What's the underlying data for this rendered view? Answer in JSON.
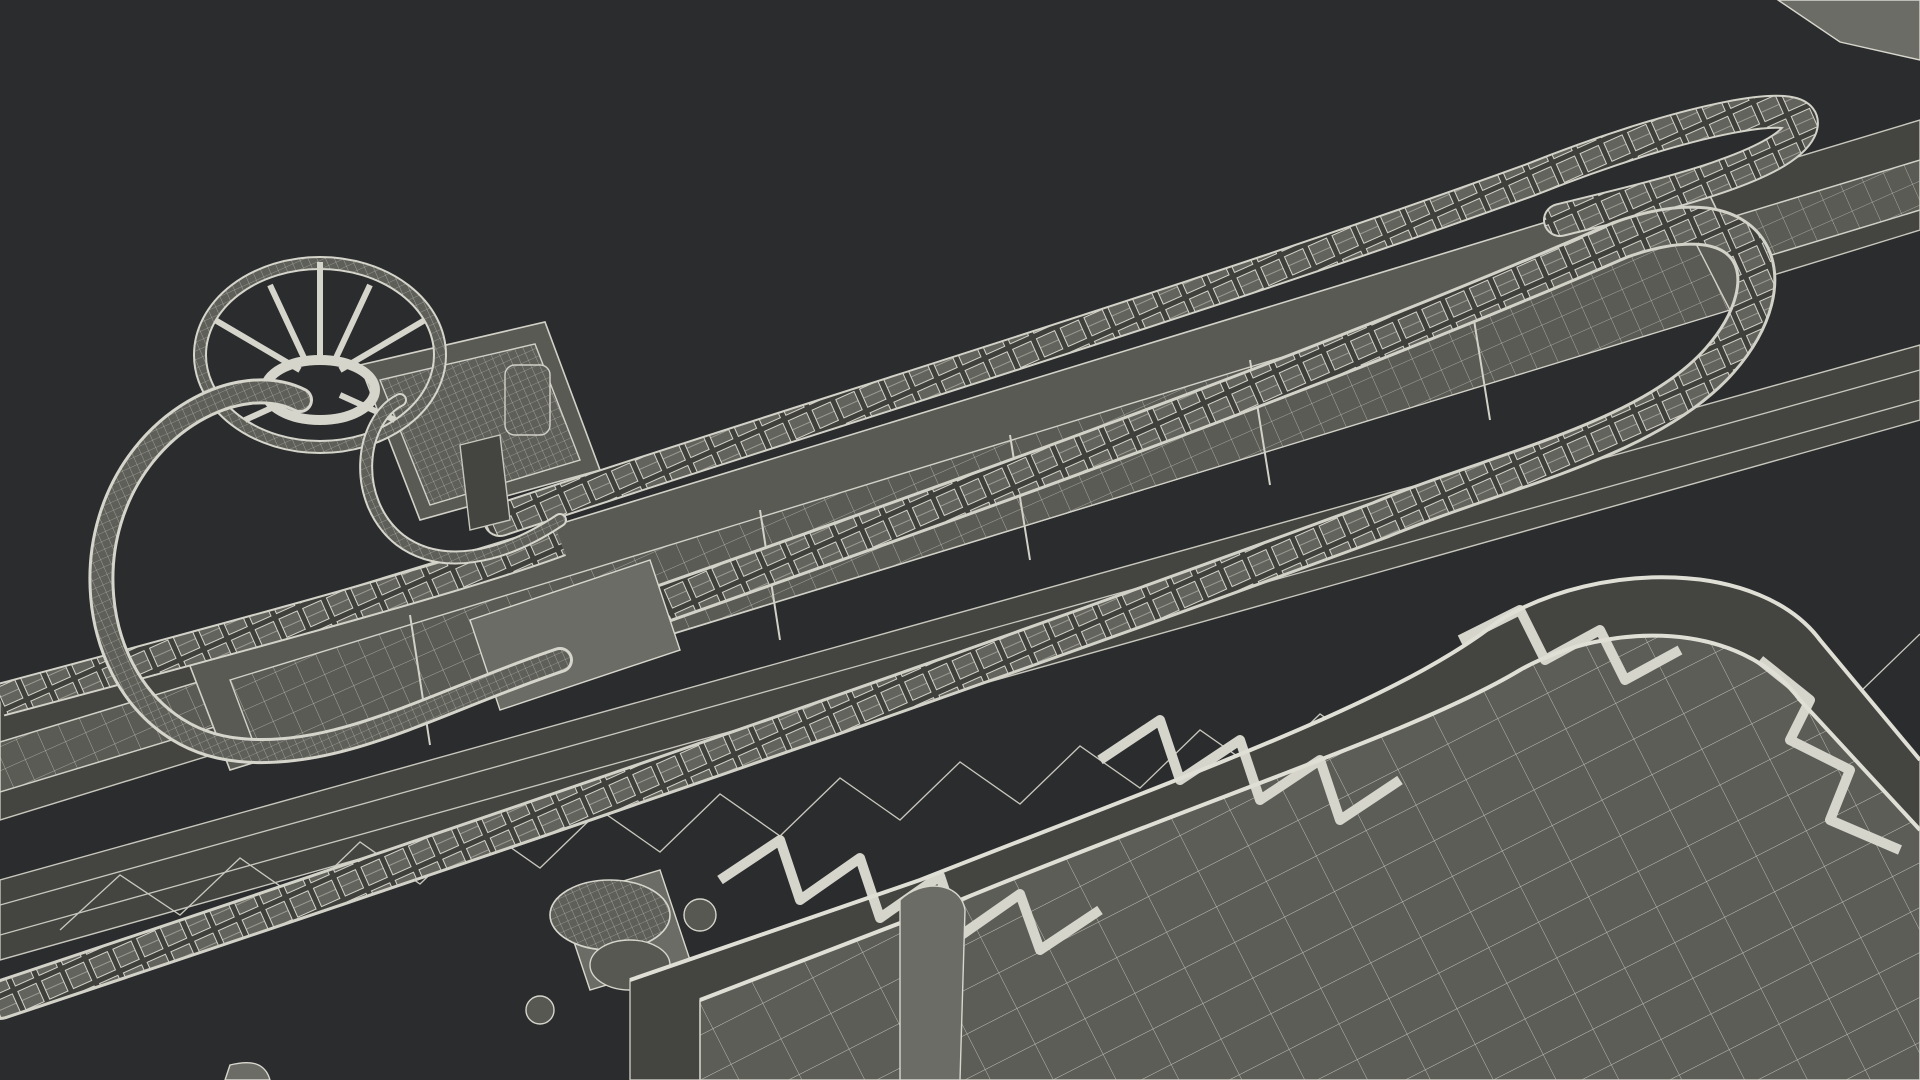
{
  "scene": {
    "background_color": "#2b2c2d",
    "wire_color": "#d6d5cc",
    "surface_color": "#595a54"
  }
}
